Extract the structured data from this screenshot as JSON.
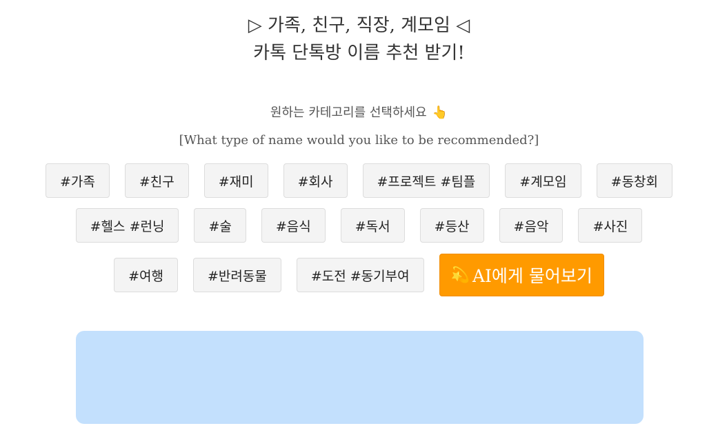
{
  "header": {
    "title_line1": "▷ 가족, 친구, 직장, 계모임 ◁",
    "title_line2": "카톡 단톡방 이름 추천 받기!"
  },
  "prompt": {
    "text": "원하는 카테고리를 선택하세요",
    "hand_icon": "👆",
    "subtext": "[What type of name would you like to be recommended?]"
  },
  "tags": {
    "row1": [
      "#가족",
      "#친구",
      "#재미",
      "#회사",
      "#프로젝트 #팀플",
      "#계모임",
      "#동창회"
    ],
    "row2": [
      "#헬스 #런닝",
      "#술",
      "#음식",
      "#독서",
      "#등산",
      "#음악",
      "#사진"
    ],
    "row3": [
      "#여행",
      "#반려동물",
      "#도전 #동기부여"
    ]
  },
  "ai_button": {
    "icon": "💫",
    "label": "AI에게 물어보기"
  },
  "result": {
    "text": ""
  },
  "colors": {
    "accent": "#ff9a00",
    "result_bg": "#c3e0fd",
    "tag_bg": "#f4f4f4"
  }
}
